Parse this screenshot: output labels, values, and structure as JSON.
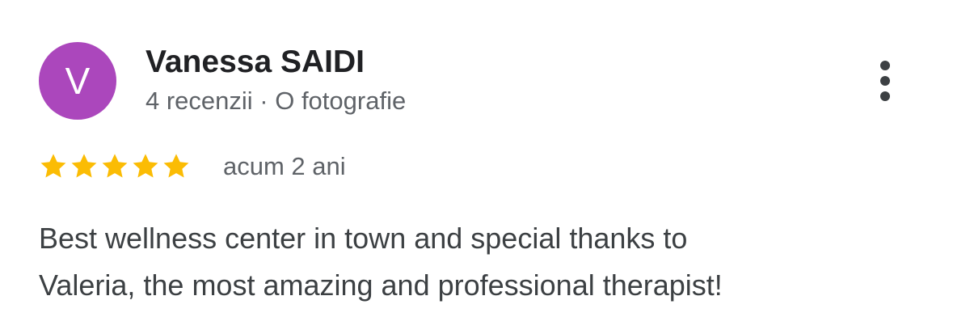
{
  "reviewer": {
    "initial": "V",
    "avatar_color": "#ab47bc",
    "name": "Vanessa SAIDI",
    "meta": "4 recenzii · O fotografie"
  },
  "menu": {
    "icon": "more-vert-icon"
  },
  "rating": {
    "stars": 5,
    "max": 5,
    "star_color": "#fbbc04",
    "time": "acum 2 ani"
  },
  "review": {
    "lines": [
      "Best wellness center in town and special thanks to",
      "Valeria, the most amazing and professional therapist!"
    ]
  }
}
